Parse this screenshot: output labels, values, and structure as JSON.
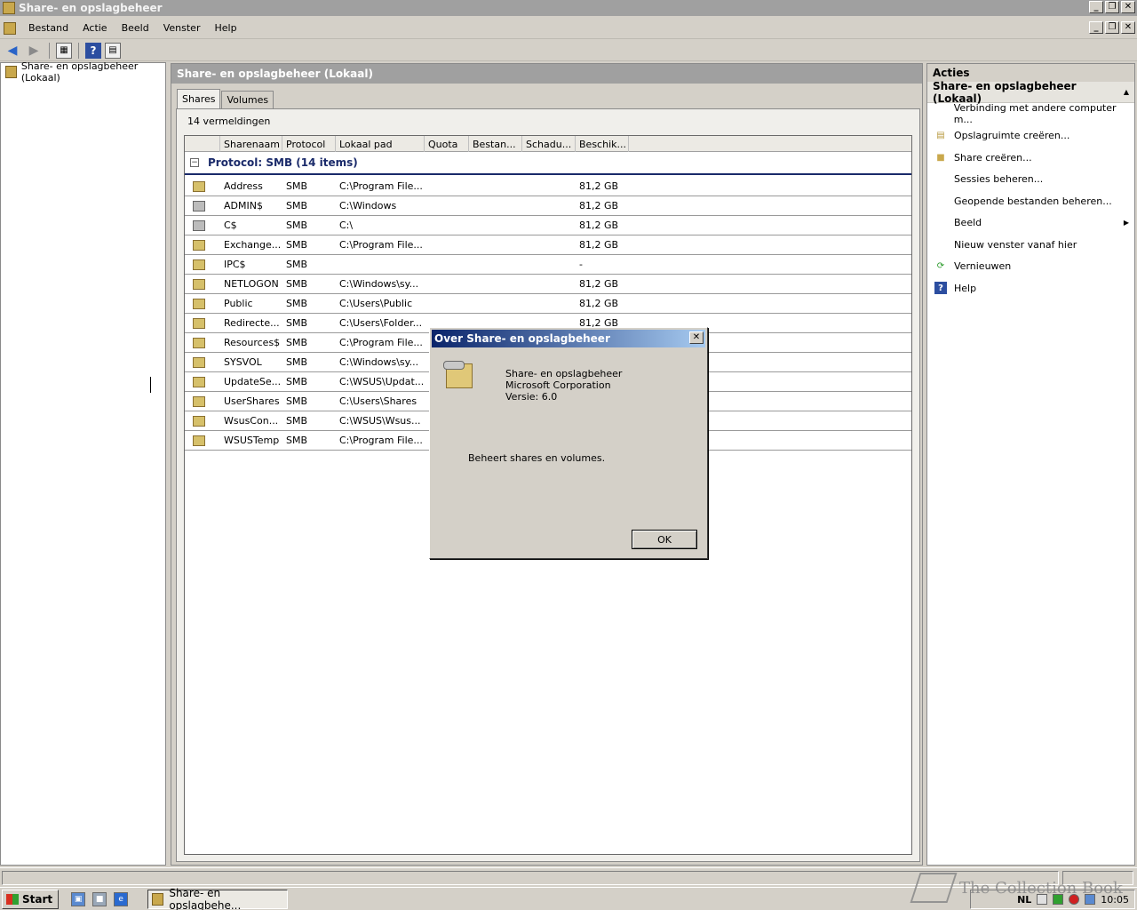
{
  "window": {
    "title": "Share- en opslagbeheer",
    "buttons": [
      "_",
      "❐",
      "✕"
    ]
  },
  "menu": {
    "items": [
      "Bestand",
      "Actie",
      "Beeld",
      "Venster",
      "Help"
    ]
  },
  "toolbar": {
    "icons": [
      "back-arrow-icon",
      "forward-arrow-icon",
      "show-hide-console-tree-icon",
      "help-icon",
      "show-hide-action-pane-icon"
    ],
    "help_glyph": "?"
  },
  "tree": {
    "root": "Share- en opslagbeheer (Lokaal)"
  },
  "center": {
    "header": "Share- en opslagbeheer (Lokaal)",
    "tabs": [
      "Shares",
      "Volumes"
    ],
    "active_tab": "Shares",
    "count_label": "14 vermeldingen",
    "columns": [
      "",
      "Sharenaam",
      "Protocol",
      "Lokaal pad",
      "Quota",
      "Bestan...",
      "Schadu...",
      "Beschik..."
    ],
    "group_label": "Protocol: SMB (14 items)",
    "rows": [
      {
        "name": "Address",
        "protocol": "SMB",
        "path": "C:\\Program File...",
        "free": "81,2 GB",
        "icon": "share"
      },
      {
        "name": "ADMIN$",
        "protocol": "SMB",
        "path": "C:\\Windows",
        "free": "81,2 GB",
        "icon": "admin"
      },
      {
        "name": "C$",
        "protocol": "SMB",
        "path": "C:\\",
        "free": "81,2 GB",
        "icon": "admin"
      },
      {
        "name": "Exchange...",
        "protocol": "SMB",
        "path": "C:\\Program File...",
        "free": "81,2 GB",
        "icon": "share"
      },
      {
        "name": "IPC$",
        "protocol": "SMB",
        "path": "",
        "free": "-",
        "icon": "share"
      },
      {
        "name": "NETLOGON",
        "protocol": "SMB",
        "path": "C:\\Windows\\sy...",
        "free": "81,2 GB",
        "icon": "share"
      },
      {
        "name": "Public",
        "protocol": "SMB",
        "path": "C:\\Users\\Public",
        "free": "81,2 GB",
        "icon": "share"
      },
      {
        "name": "Redirecte...",
        "protocol": "SMB",
        "path": "C:\\Users\\Folder...",
        "free": "81,2 GB",
        "icon": "share"
      },
      {
        "name": "Resources$",
        "protocol": "SMB",
        "path": "C:\\Program File...",
        "free": "",
        "icon": "share"
      },
      {
        "name": "SYSVOL",
        "protocol": "SMB",
        "path": "C:\\Windows\\sy...",
        "free": "",
        "icon": "share"
      },
      {
        "name": "UpdateSe...",
        "protocol": "SMB",
        "path": "C:\\WSUS\\Updat...",
        "free": "",
        "icon": "share"
      },
      {
        "name": "UserShares",
        "protocol": "SMB",
        "path": "C:\\Users\\Shares",
        "free": "",
        "icon": "share"
      },
      {
        "name": "WsusCon...",
        "protocol": "SMB",
        "path": "C:\\WSUS\\Wsus...",
        "free": "",
        "icon": "share"
      },
      {
        "name": "WSUSTemp",
        "protocol": "SMB",
        "path": "C:\\Program File...",
        "free": "",
        "icon": "share"
      }
    ]
  },
  "actions": {
    "header": "Acties",
    "section": "Share- en opslagbeheer (Lokaal)",
    "items": [
      {
        "label": "Verbinding met andere computer m...",
        "icon": ""
      },
      {
        "label": "Opslagruimte creëren...",
        "icon": "storage-icon"
      },
      {
        "label": "Share creëren...",
        "icon": "share-icon"
      },
      {
        "label": "Sessies beheren...",
        "icon": ""
      },
      {
        "label": "Geopende bestanden beheren...",
        "icon": ""
      },
      {
        "label": "Beeld",
        "icon": "",
        "submenu": true
      },
      {
        "label": "Nieuw venster vanaf hier",
        "icon": ""
      },
      {
        "label": "Vernieuwen",
        "icon": "refresh-icon"
      },
      {
        "label": "Help",
        "icon": "help-icon"
      }
    ]
  },
  "dialog": {
    "title": "Over Share- en opslagbeheer",
    "product": "Share- en opslagbeheer",
    "company": "Microsoft Corporation",
    "version": "Versie: 6.0",
    "description": "Beheert shares en volumes.",
    "ok_label": "OK",
    "close_glyph": "✕"
  },
  "taskbar": {
    "start_label": "Start",
    "task_label": "Share- en opslagbehe...",
    "language": "NL",
    "clock": "10:05"
  },
  "watermark": {
    "text": "The Collection Book"
  }
}
